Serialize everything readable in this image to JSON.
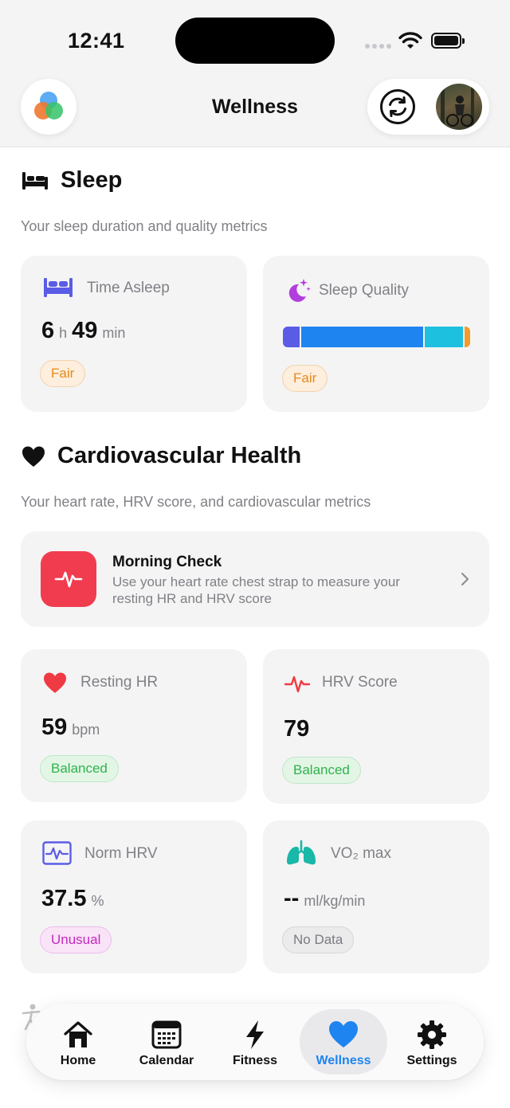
{
  "status_bar": {
    "time": "12:41"
  },
  "header": {
    "title": "Wellness"
  },
  "sleep": {
    "title": "Sleep",
    "subtitle": "Your sleep duration and quality metrics",
    "time_asleep": {
      "label": "Time Asleep",
      "hours": "6",
      "hours_unit": "h",
      "minutes": "49",
      "minutes_unit": "min",
      "badge": "Fair"
    },
    "sleep_quality": {
      "label": "Sleep Quality",
      "badge": "Fair",
      "stages": [
        {
          "stage": "segment-1",
          "fraction": 0.09,
          "color": "#5b5ce6"
        },
        {
          "stage": "segment-2",
          "fraction": 0.67,
          "color": "#1e84f0"
        },
        {
          "stage": "segment-3",
          "fraction": 0.21,
          "color": "#1ec0e0"
        },
        {
          "stage": "segment-4",
          "fraction": 0.03,
          "color": "#f39a2b"
        }
      ]
    }
  },
  "cardio": {
    "title": "Cardiovascular Health",
    "subtitle": "Your heart rate, HRV score, and cardiovascular metrics",
    "morning_check": {
      "title": "Morning Check",
      "description": "Use your heart rate chest strap to measure your resting HR and HRV score"
    },
    "resting_hr": {
      "label": "Resting HR",
      "value": "59",
      "unit": "bpm",
      "badge": "Balanced"
    },
    "hrv_score": {
      "label": "HRV Score",
      "value": "79",
      "badge": "Balanced"
    },
    "norm_hrv": {
      "label": "Norm HRV",
      "value": "37.5",
      "unit": "%",
      "badge": "Unusual"
    },
    "vo2max": {
      "label": "VO₂ max",
      "value": "--",
      "unit": "ml/kg/min",
      "badge": "No Data"
    }
  },
  "tabs": [
    {
      "label": "Home",
      "icon": "home-icon"
    },
    {
      "label": "Calendar",
      "icon": "calendar-icon"
    },
    {
      "label": "Fitness",
      "icon": "bolt-icon"
    },
    {
      "label": "Wellness",
      "icon": "heart-icon",
      "active": true
    },
    {
      "label": "Settings",
      "icon": "gear-icon"
    }
  ],
  "colors": {
    "accent": "#1e84f0",
    "danger": "#f13c4f",
    "fair": "#e8891b",
    "balanced": "#2fb24d",
    "unusual": "#c428c0"
  }
}
